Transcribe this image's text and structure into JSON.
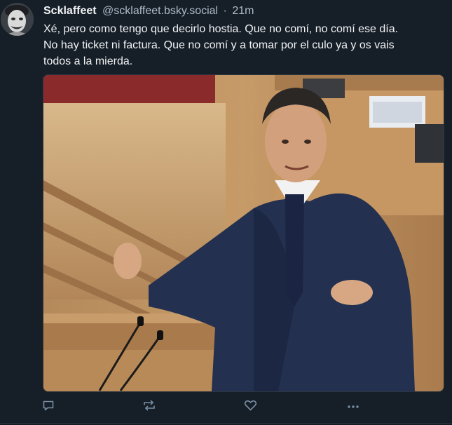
{
  "post": {
    "author": {
      "display_name": "Scklaffeet",
      "handle": "@scklaffeet.bsky.social"
    },
    "separator": "·",
    "timestamp": "21m",
    "text": "Xé, pero como tengo que decirlo hostia. Que no comí, no comí ese día.\nNo hay ticket ni factura. Que no comí y a tomar por el culo ya y os vais\ntodos a la mierda.",
    "media": {
      "type": "photo"
    }
  },
  "actions": {
    "reply_icon": "reply-icon",
    "repost_icon": "repost-icon",
    "like_icon": "heart-icon",
    "more_icon": "more-options-icon"
  },
  "colors": {
    "background": "#161e27",
    "text": "#f1f3f5",
    "muted": "#aebbc9",
    "icon": "#788ea5"
  }
}
